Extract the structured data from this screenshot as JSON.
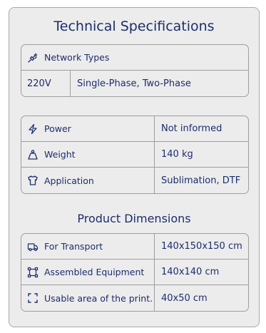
{
  "title": "Technical Specifications",
  "network": {
    "header": {
      "icon": "plug-icon",
      "label": "Network Types"
    },
    "voltage": "220V",
    "phases": "Single-Phase, Two-Phase"
  },
  "specs": [
    {
      "icon": "lightning-icon",
      "label": "Power",
      "value": "Not informed"
    },
    {
      "icon": "weight-icon",
      "label": "Weight",
      "value": "140 kg"
    },
    {
      "icon": "shirt-icon",
      "label": "Application",
      "value": "Sublimation, DTF"
    }
  ],
  "dimensions_title": "Product Dimensions",
  "dimensions": [
    {
      "icon": "truck-icon",
      "label": "For Transport",
      "value": "140x150x150 cm"
    },
    {
      "icon": "bounding-box-icon",
      "label": "Assembled Equipment",
      "value": "140x140 cm"
    },
    {
      "icon": "crop-frame-icon",
      "label": "Usable area of the print.",
      "value": "40x50 cm"
    }
  ],
  "colors": {
    "text": "#1c2e6b",
    "card_bg": "#ececec",
    "border": "#9e9e9e"
  }
}
